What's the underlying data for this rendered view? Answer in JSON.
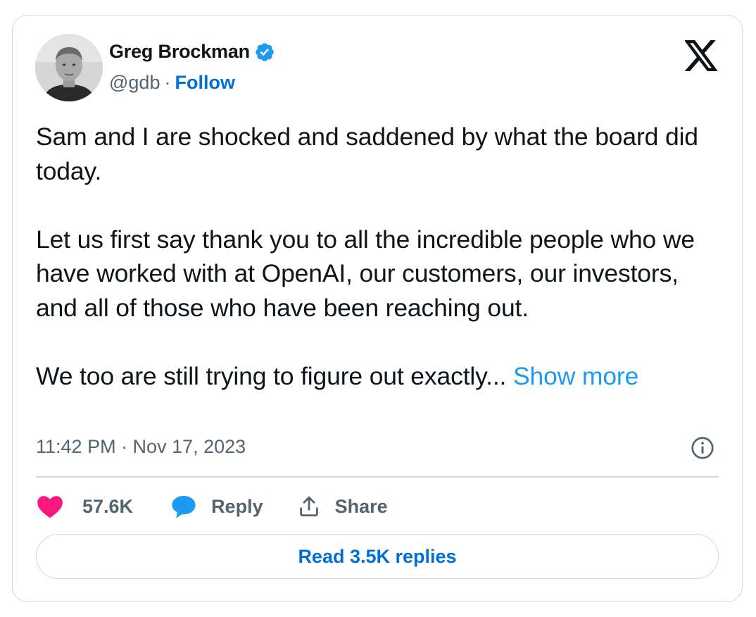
{
  "author": {
    "display_name": "Greg Brockman",
    "handle": "@gdb",
    "separator": "·",
    "follow_label": "Follow",
    "verified": true
  },
  "tweet": {
    "paragraph_1": "Sam and I are shocked and saddened by what the board did today.",
    "paragraph_2": "Let us first say thank you to all the incredible people who we have worked with at OpenAI, our customers, our investors, and all of those who have been reaching out.",
    "paragraph_3": "We too are still trying to figure out exactly...",
    "show_more_label": "Show more",
    "timestamp": "11:42 PM · Nov 17, 2023"
  },
  "actions": {
    "like_count": "57.6K",
    "reply_label": "Reply",
    "share_label": "Share"
  },
  "replies_button_label": "Read 3.5K replies",
  "icons": {
    "brand": "x-logo-icon",
    "verified": "verified-badge-icon",
    "info": "info-icon",
    "like": "heart-icon",
    "reply": "speech-bubble-icon",
    "share": "upload-share-icon"
  },
  "colors": {
    "link_blue": "#006fd6",
    "show_more_blue": "#1d9bf0",
    "verified_blue": "#1d9bf0",
    "like_pink": "#f91880",
    "secondary_text": "#536471",
    "border": "#cfd9de"
  }
}
